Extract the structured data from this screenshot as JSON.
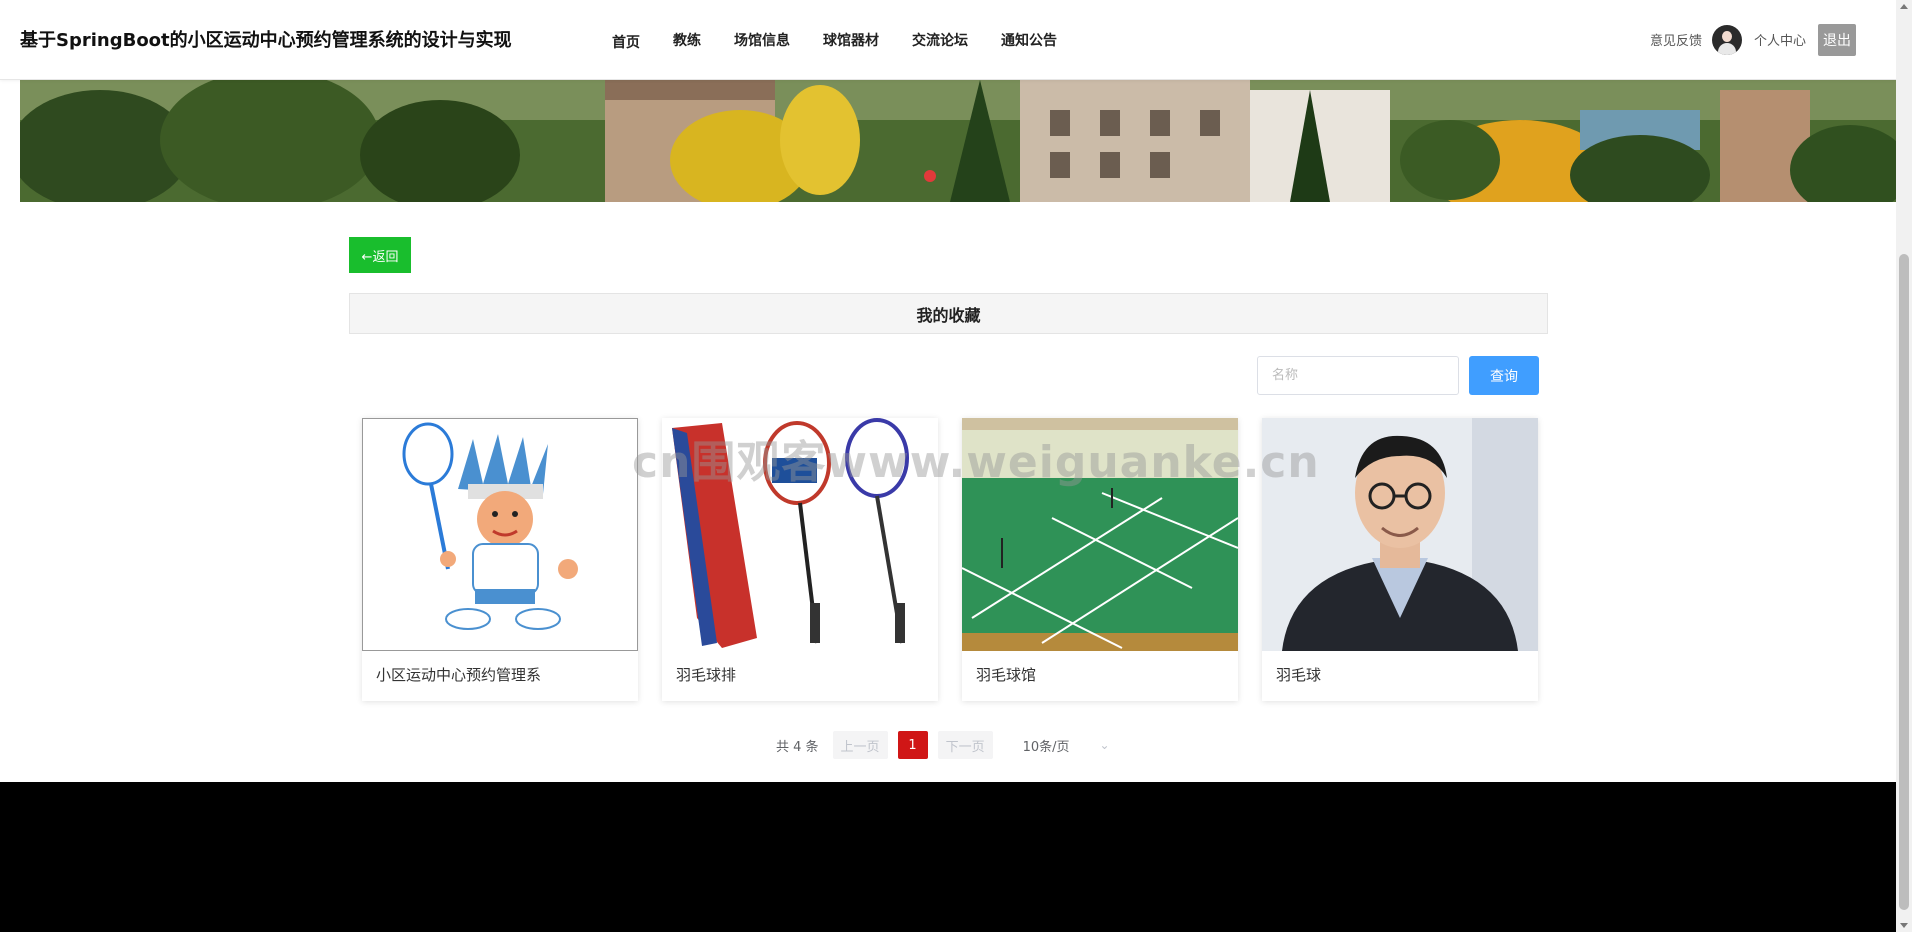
{
  "header": {
    "title": "基于SpringBoot的小区运动中心预约管理系统的设计与实现",
    "nav": [
      "首页",
      "教练",
      "场馆信息",
      "球馆器材",
      "交流论坛",
      "通知公告"
    ],
    "feedback": "意见反馈",
    "personal_center": "个人中心",
    "logout": "退出"
  },
  "content": {
    "back_label": "←返回",
    "section_title": "我的收藏",
    "search_placeholder": "名称",
    "search_button": "查询",
    "cards": [
      {
        "name": "小区运动中心预约管理系"
      },
      {
        "name": "羽毛球排"
      },
      {
        "name": "羽毛球馆"
      },
      {
        "name": "羽毛球"
      }
    ],
    "watermark": "cn围观客www.weiguanke.cn"
  },
  "pagination": {
    "total": "共 4 条",
    "prev": "上一页",
    "current": "1",
    "next": "下一页",
    "page_size": "10条/页"
  },
  "colors": {
    "back_button": "#19be2d",
    "search_button": "#409eff",
    "active_page": "#d01616",
    "logout_button": "#999999"
  },
  "icons": [
    "chevron-down-icon",
    "arrow-left-icon"
  ]
}
